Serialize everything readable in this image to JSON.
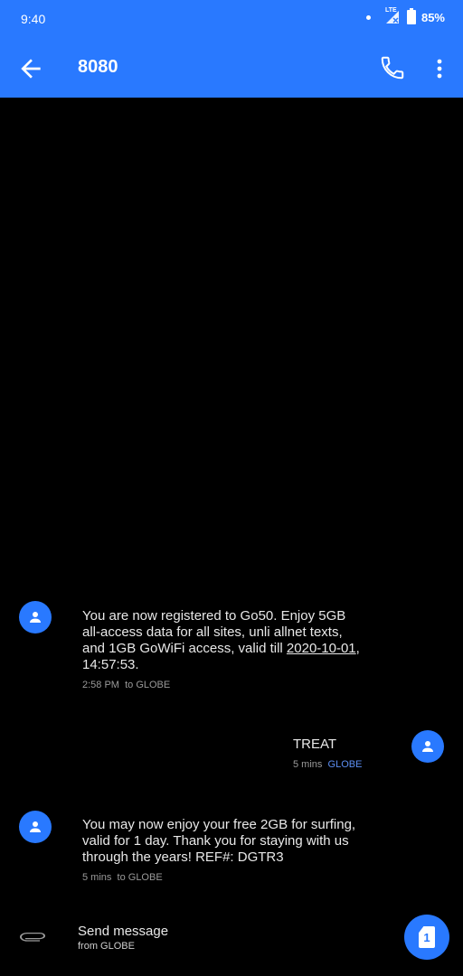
{
  "status_bar": {
    "time": "9:40",
    "network": "LTE",
    "battery": "85%"
  },
  "header": {
    "title": "8080",
    "back_icon": "arrow-left-icon",
    "call_icon": "phone-icon",
    "menu_icon": "more-vert-icon"
  },
  "messages": [
    {
      "direction": "incoming",
      "text_pre": "You are now registered to Go50. Enjoy 5GB all-access data for all sites, unli allnet texts, and 1GB GoWiFi access, valid till ",
      "text_link": "2020-10-01",
      "text_post": ", 14:57:53.",
      "time": "2:58 PM",
      "sim": "to GLOBE"
    },
    {
      "direction": "outgoing",
      "text": "TREAT",
      "time": "5 mins",
      "sim": "GLOBE"
    },
    {
      "direction": "incoming",
      "text": "You may now enjoy your free 2GB for surfing, valid for 1 day. Thank you for staying with us through the years! REF#: DGTR3",
      "time": "5 mins",
      "sim": "to GLOBE"
    }
  ],
  "compose": {
    "label": "Send message",
    "sublabel": "from GLOBE",
    "sim_number": "1"
  },
  "colors": {
    "accent": "#2979ff",
    "background": "#000000",
    "meta_blue": "#5b8df0"
  }
}
